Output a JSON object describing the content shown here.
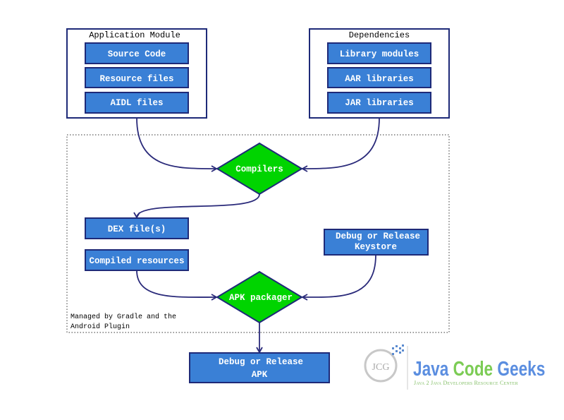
{
  "app_module": {
    "title": "Application Module",
    "items": [
      "Source Code",
      "Resource files",
      "AIDL files"
    ]
  },
  "dependencies": {
    "title": "Dependencies",
    "items": [
      "Library modules",
      "AAR libraries",
      "JAR libraries"
    ]
  },
  "compilers": "Compilers",
  "dex": "DEX file(s)",
  "compiled_resources": "Compiled resources",
  "keystore": [
    "Debug or Release",
    "Keystore"
  ],
  "apk_packager": "APK packager",
  "output": [
    "Debug or Release",
    "APK"
  ],
  "gradle_note": [
    "Managed by Gradle and the",
    "Android Plugin"
  ],
  "logo": {
    "mark": "JCG",
    "name_parts": [
      "Java",
      "Code",
      "Geeks"
    ],
    "tagline": "Java 2 Java Developers Resource Center"
  },
  "colors": {
    "box": "#3a80d6",
    "border": "#1e2a78",
    "diamond": "#00d400"
  }
}
